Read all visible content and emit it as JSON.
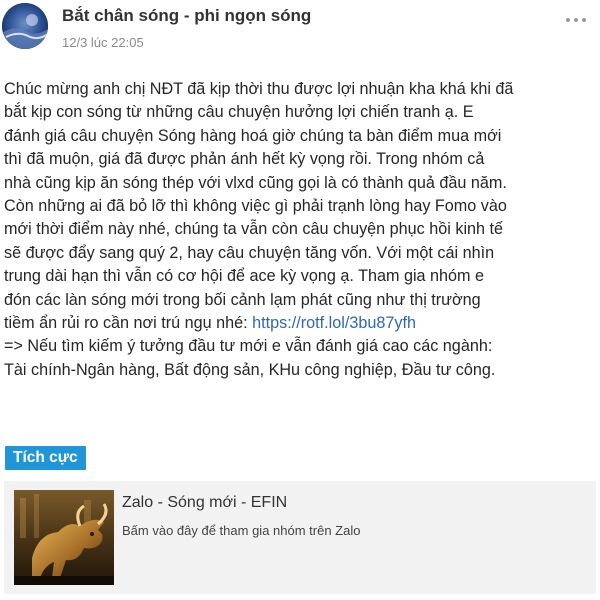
{
  "post": {
    "author": "Bắt chân sóng - phi ngọn sóng",
    "timestamp": "12/3 lúc 22:05",
    "more_icon": "more-options-icon",
    "body_lines": [
      "Chúc mừng anh chị NĐT đã kịp thời thu được lợi nhuận kha khá khi đã",
      "bắt kịp con sóng từ những câu chuyện hưởng lợi chiến tranh ạ. E",
      "đánh giá câu chuyện Sóng hàng hoá giờ chúng ta bàn điểm mua mới",
      "thì đã muộn, giá đã được phản ánh hết kỳ vọng rồi. Trong nhóm cả",
      "nhà cũng kịp ăn sóng thép với vlxd cũng gọi là có thành quả đầu năm.",
      "Còn những ai đã bỏ lỡ thì không việc gì phải trạnh lòng hay Fomo vào",
      "mới thời điểm này nhé, chúng ta vẫn còn câu chuyện phục hồi kinh tế",
      "sẽ được đẩy sang quý 2, hay câu chuyện tăng vốn. Với một cái nhìn",
      "trung dài hạn thì vẫn có cơ hội để ace kỳ vọng ạ. Tham gia nhóm e",
      "đón các làn sóng mới trong bối cảnh lạm phát cũng như thị trường"
    ],
    "link_prefix": "tiềm ẩn rủi ro cần nơi trú ngụ nhé: ",
    "link_url": "https://rotf.lol/3bu87yfh",
    "after_lines": [
      "=> Nếu tìm kiếm ý tưởng đầu tư mới e vẫn đánh giá cao các ngành:",
      "Tài chính-Ngân hàng, Bất động sản, KHu công nghiệp, Đầu tư công."
    ],
    "sentiment_tag": "Tích cực",
    "link_card": {
      "title": "Zalo - Sóng mới - EFIN",
      "description": "Bấm vào đây để tham gia nhóm trên Zalo"
    },
    "colors": {
      "link": "#2f67b8",
      "tag_background": "#1f96d8",
      "card_background": "#f2f2f2"
    }
  }
}
